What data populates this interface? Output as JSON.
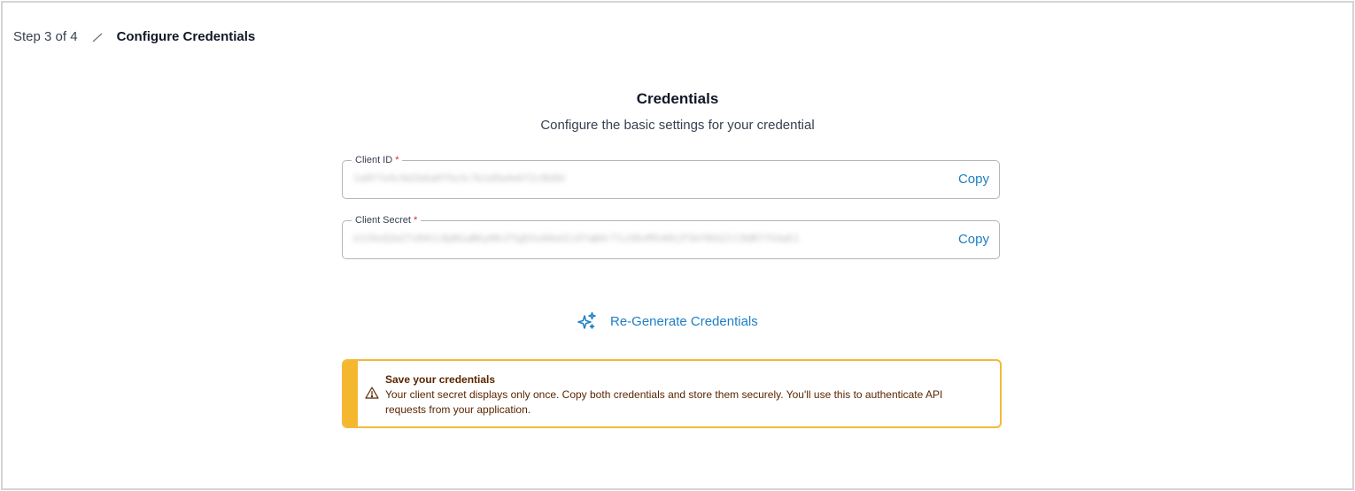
{
  "breadcrumb": {
    "step": "Step 3 of 4",
    "current": "Configure Credentials"
  },
  "header": {
    "title": "Credentials",
    "subtitle": "Configure the basic settings for your credential"
  },
  "fields": [
    {
      "label": "Client ID",
      "required_mark": "*",
      "value": "1a8f7e4c9d2b6a0f5e3c7b1d9a4e6f2c8b0d",
      "copy_label": "Copy"
    },
    {
      "label": "Client Secret",
      "required_mark": "*",
      "value": "k3J9xQ2mZ7vR4tL8pN1wB6yH0cF5gD3sA9eU2iO7qW4rT1zX8vM5nK6jP3bY0hG2lC9dR7fS4aE1",
      "copy_label": "Copy"
    }
  ],
  "regenerate": {
    "label": "Re-Generate Credentials",
    "icon": "sparkles-icon"
  },
  "alert": {
    "icon": "warning-triangle-icon",
    "title": "Save your credentials",
    "message": "Your client secret displays only once. Copy both credentials and store them securely. You'll use this to authenticate API requests from your application."
  },
  "colors": {
    "accent": "#1d7fc4",
    "warning_bar": "#f5b72e",
    "warning_border": "#f4b83a",
    "warning_text": "#5b2500",
    "required": "#dc2626"
  }
}
